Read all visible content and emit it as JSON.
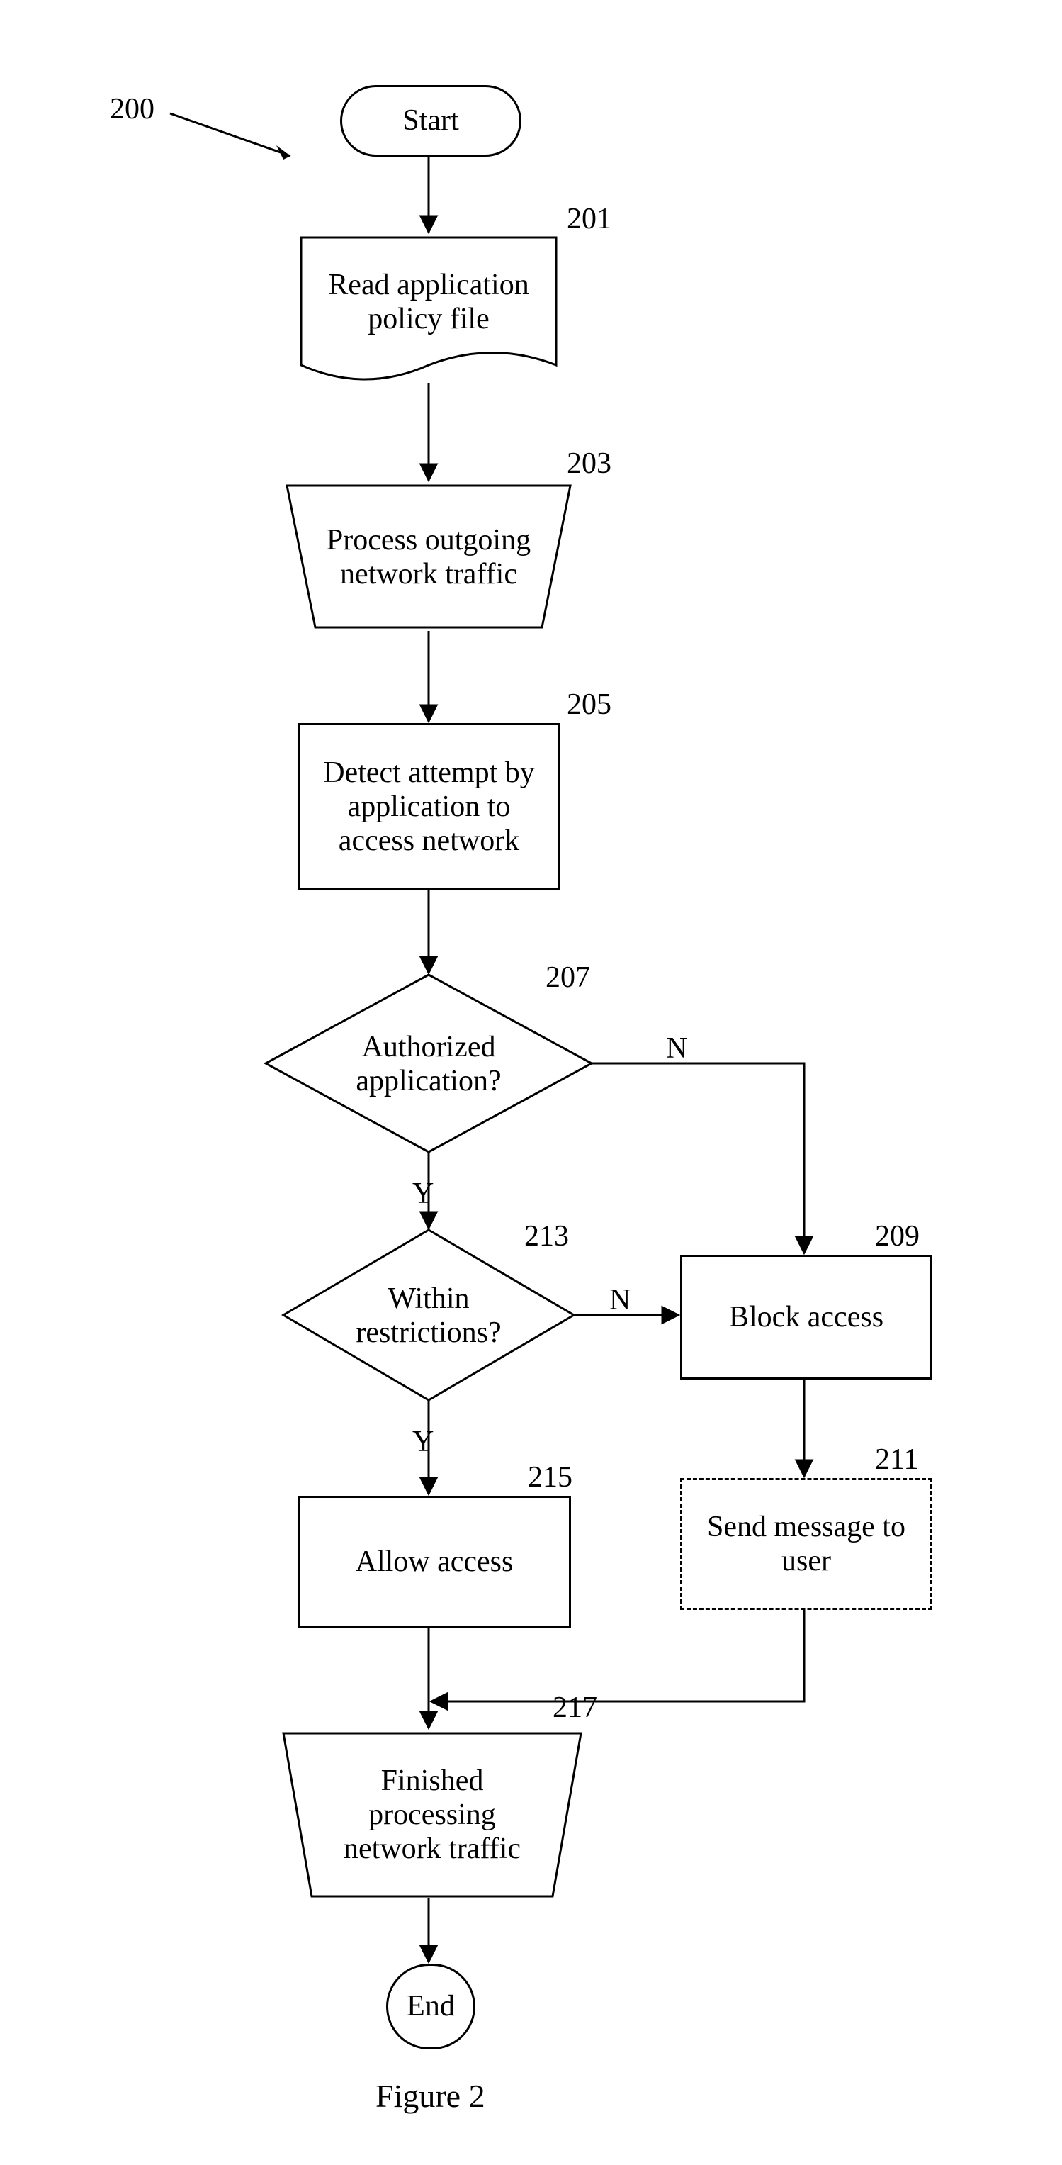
{
  "figure_label_ref": "200",
  "caption": "Figure 2",
  "nodes": {
    "start": {
      "num": "",
      "text": "Start"
    },
    "read_policy": {
      "num": "201",
      "text": "Read application policy file"
    },
    "process_out": {
      "num": "203",
      "text": "Process outgoing network traffic"
    },
    "detect": {
      "num": "205",
      "text": "Detect attempt by application to access network"
    },
    "authorized": {
      "num": "207",
      "text": "Authorized application?"
    },
    "within": {
      "num": "213",
      "text": "Within restrictions?"
    },
    "block": {
      "num": "209",
      "text": "Block access"
    },
    "msg": {
      "num": "211",
      "text": "Send message to user"
    },
    "allow": {
      "num": "215",
      "text": "Allow access"
    },
    "finished": {
      "num": "217",
      "text": "Finished processing network traffic"
    },
    "end": {
      "num": "",
      "text": "End"
    }
  },
  "edges": {
    "authorized_yes": "Y",
    "authorized_no": "N",
    "within_yes": "Y",
    "within_no": "N"
  },
  "chart_data": {
    "type": "flowchart",
    "title": "Figure 2 — process 200",
    "nodes": [
      {
        "id": "start",
        "kind": "terminator",
        "label": "Start"
      },
      {
        "id": "201",
        "kind": "document",
        "label": "Read application policy file"
      },
      {
        "id": "203",
        "kind": "manual-operation",
        "label": "Process outgoing network traffic"
      },
      {
        "id": "205",
        "kind": "process",
        "label": "Detect attempt by application to access network"
      },
      {
        "id": "207",
        "kind": "decision",
        "label": "Authorized application?"
      },
      {
        "id": "213",
        "kind": "decision",
        "label": "Within restrictions?"
      },
      {
        "id": "209",
        "kind": "process",
        "label": "Block access"
      },
      {
        "id": "211",
        "kind": "process-optional",
        "label": "Send message to user"
      },
      {
        "id": "215",
        "kind": "process",
        "label": "Allow access"
      },
      {
        "id": "217",
        "kind": "manual-operation",
        "label": "Finished processing network traffic"
      },
      {
        "id": "end",
        "kind": "terminator",
        "label": "End"
      }
    ],
    "edges": [
      {
        "from": "start",
        "to": "201"
      },
      {
        "from": "201",
        "to": "203"
      },
      {
        "from": "203",
        "to": "205"
      },
      {
        "from": "205",
        "to": "207"
      },
      {
        "from": "207",
        "to": "213",
        "label": "Y"
      },
      {
        "from": "207",
        "to": "209",
        "label": "N"
      },
      {
        "from": "213",
        "to": "215",
        "label": "Y"
      },
      {
        "from": "213",
        "to": "209",
        "label": "N"
      },
      {
        "from": "209",
        "to": "211"
      },
      {
        "from": "215",
        "to": "217"
      },
      {
        "from": "211",
        "to": "217"
      },
      {
        "from": "217",
        "to": "end"
      }
    ]
  }
}
